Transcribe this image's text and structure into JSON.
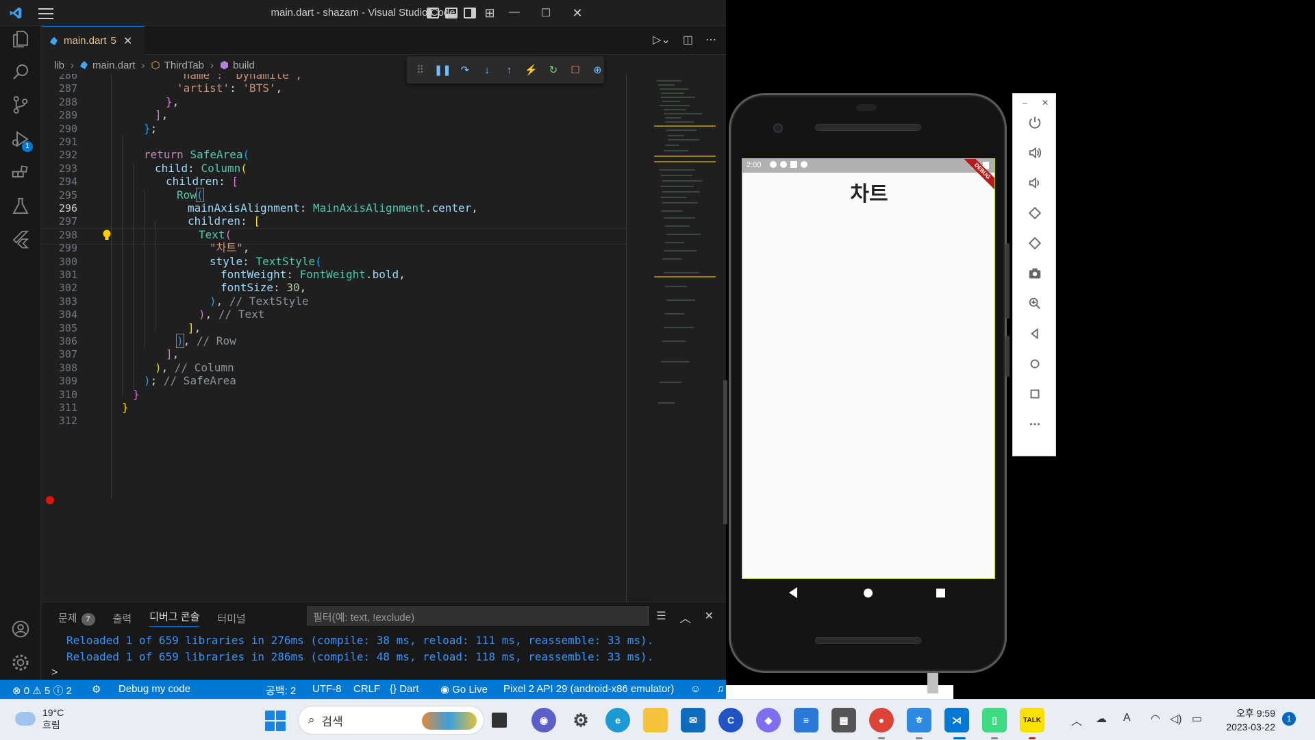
{
  "window": {
    "title": "main.dart - shazam - Visual Studio Code"
  },
  "tab": {
    "name": "main.dart",
    "problems": "5",
    "close": "✕"
  },
  "breadcrumb": {
    "items": [
      "lib",
      "main.dart",
      "ThirdTab",
      "build"
    ]
  },
  "editor": {
    "lines": [
      {
        "n": "286"
      },
      {
        "n": "287"
      },
      {
        "n": "288"
      },
      {
        "n": "289"
      },
      {
        "n": "290"
      },
      {
        "n": "291"
      },
      {
        "n": "292"
      },
      {
        "n": "293"
      },
      {
        "n": "294"
      },
      {
        "n": "295"
      },
      {
        "n": "296"
      },
      {
        "n": "297"
      },
      {
        "n": "298"
      },
      {
        "n": "299"
      },
      {
        "n": "300"
      },
      {
        "n": "301"
      },
      {
        "n": "302"
      },
      {
        "n": "303"
      },
      {
        "n": "304"
      },
      {
        "n": "305"
      },
      {
        "n": "306"
      },
      {
        "n": "307"
      },
      {
        "n": "308"
      },
      {
        "n": "309"
      },
      {
        "n": "310"
      },
      {
        "n": "311"
      },
      {
        "n": "312"
      }
    ],
    "code": {
      "l286": "'name': 'Dynamite',",
      "l287_key": "'artist'",
      "l287_val": "'BTS'",
      "l292_kw": "return",
      "l292_cls": "SafeArea",
      "l293_prop": "child",
      "l293_cls": "Column",
      "l294_prop": "children",
      "l295_cls": "Row",
      "l296_prop": "mainAxisAlignment",
      "l296_cls": "MainAxisAlignment",
      "l296_val": "center",
      "l297_prop": "children",
      "l298_cls": "Text",
      "l299_str": "\"차트\"",
      "l300_prop": "style",
      "l300_cls": "TextStyle",
      "l301_prop": "fontWeight",
      "l301_cls": "FontWeight",
      "l301_val": "bold",
      "l302_prop": "fontSize",
      "l302_num": "30",
      "l303_cmt": "// TextStyle",
      "l304_cmt": "// Text",
      "l306_cmt": "// Row",
      "l308_cmt": "// Column",
      "l309_cmt": "// SafeArea"
    }
  },
  "panel": {
    "tabs": [
      "문제",
      "출력",
      "디버그 콘솔",
      "터미널"
    ],
    "problems_count": "7",
    "filter_placeholder": "필터(예: text, !exclude)",
    "console": [
      "Reloaded 1 of 659 libraries in 276ms (compile: 38 ms, reload: 111 ms, reassemble: 33 ms).",
      "Reloaded 1 of 659 libraries in 286ms (compile: 48 ms, reload: 118 ms, reassemble: 33 ms)."
    ],
    "prompt": ">"
  },
  "statusbar": {
    "errors": "0",
    "warnings": "5",
    "infos": "2",
    "debug": "Debug my code",
    "spaces": "공백: 2",
    "encoding": "UTF-8",
    "eol": "CRLF",
    "language": "Dart",
    "golive": "Go Live",
    "device": "Pixel 2 API 29 (android-x86 emulator)"
  },
  "emulator": {
    "time": "2:00",
    "app_title": "차트",
    "debug_ribbon": "DEBUG"
  },
  "taskbar": {
    "weather_temp": "19°C",
    "weather_desc": "흐림",
    "search": "검색",
    "clock_time": "오후 9:59",
    "clock_date": "2023-03-22",
    "notifications": "1",
    "kakao": "TALK"
  },
  "colors": {
    "accent": "#0078d4",
    "editor_bg": "#1f1f1f",
    "console_text": "#3794ff"
  }
}
